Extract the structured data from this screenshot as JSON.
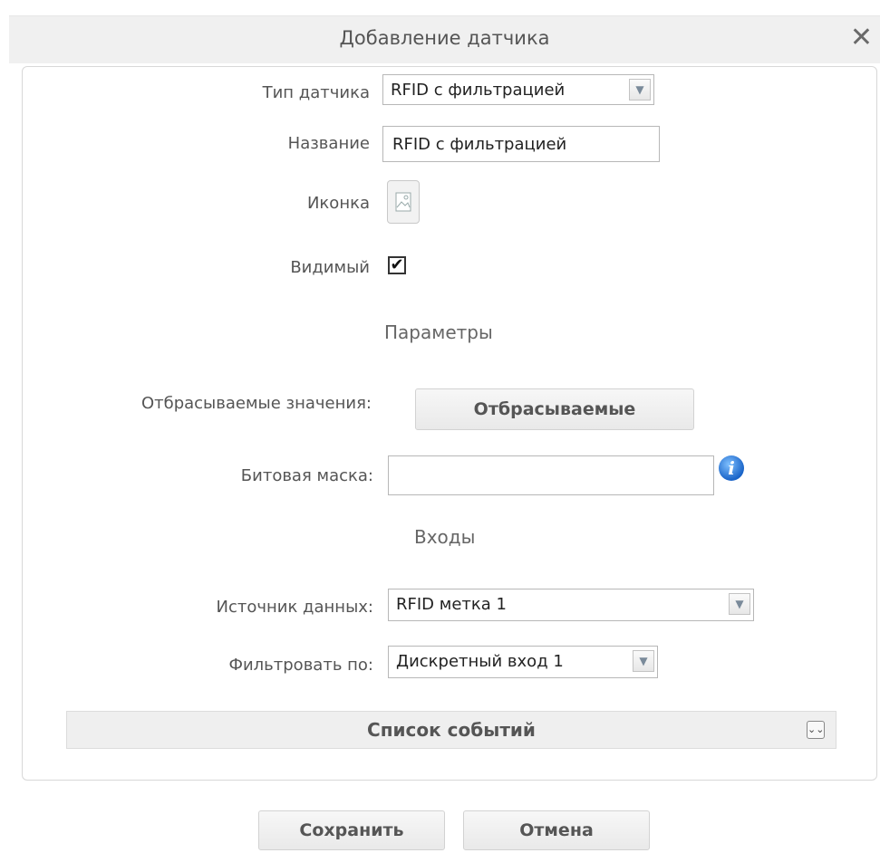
{
  "dialog": {
    "title": "Добавление датчика",
    "close_icon": "close-icon"
  },
  "form": {
    "sensor_type_label": "Тип датчика",
    "sensor_type_value": "RFID с фильтрацией",
    "name_label": "Название",
    "name_value": "RFID с фильтрацией",
    "icon_label": "Иконка",
    "visible_label": "Видимый",
    "visible_checked": true
  },
  "parameters": {
    "header": "Параметры",
    "discard_label": "Отбрасываемые значения:",
    "discard_button": "Отбрасываемые",
    "bitmask_label": "Битовая маска:",
    "bitmask_value": ""
  },
  "inputs": {
    "header": "Входы",
    "source_label": "Источник данных:",
    "source_value": "RFID метка 1",
    "filter_label": "Фильтровать по:",
    "filter_value": "Дискретный вход 1"
  },
  "events": {
    "label": "Список событий"
  },
  "footer": {
    "save_label": "Сохранить",
    "cancel_label": "Отмена"
  }
}
